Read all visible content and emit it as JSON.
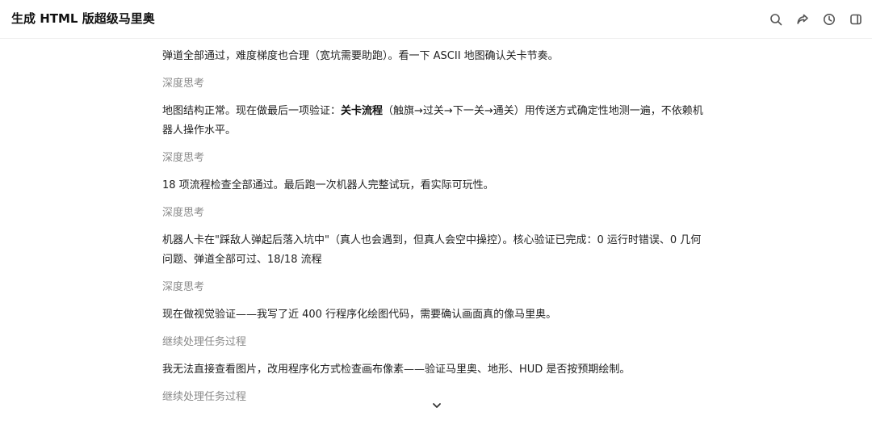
{
  "header": {
    "title": "生成 HTML 版超级马里奥",
    "icons": [
      "search-icon",
      "share-icon",
      "history-icon",
      "sidebar-toggle-icon"
    ]
  },
  "messages": [
    {
      "type": "text",
      "text": "弹道全部通过，难度梯度也合理（宽坑需要助跑）。看一下 ASCII 地图确认关卡节奏。"
    },
    {
      "type": "thinking",
      "label": "深度思考"
    },
    {
      "type": "text_rich",
      "before": "地图结构正常。现在做最后一项验证：",
      "bold": "关卡流程",
      "after": "（触旗→过关→下一关→通关）用传送方式确定性地测一遍，不依赖机器人操作水平。"
    },
    {
      "type": "thinking",
      "label": "深度思考"
    },
    {
      "type": "text",
      "text": "18 项流程检查全部通过。最后跑一次机器人完整试玩，看实际可玩性。"
    },
    {
      "type": "thinking",
      "label": "深度思考"
    },
    {
      "type": "text",
      "text": "机器人卡在\"踩敌人弹起后落入坑中\"（真人也会遇到，但真人会空中操控）。核心验证已完成：0 运行时错误、0 几何问题、弹道全部可过、18/18 流程"
    },
    {
      "type": "thinking",
      "label": "深度思考"
    },
    {
      "type": "text",
      "text": "现在做视觉验证——我写了近 400 行程序化绘图代码，需要确认画面真的像马里奥。"
    },
    {
      "type": "thinking",
      "label": "继续处理任务过程"
    },
    {
      "type": "text",
      "text": "我无法直接查看图片，改用程序化方式检查画布像素——验证马里奥、地形、HUD 是否按预期绘制。"
    },
    {
      "type": "thinking",
      "label": "继续处理任务过程"
    }
  ],
  "scroll_button": {
    "icon": "chevron-down-icon"
  },
  "colors": {
    "text": "#1f1f1f",
    "muted": "#8a8a8a",
    "divider": "#eeeeee"
  }
}
